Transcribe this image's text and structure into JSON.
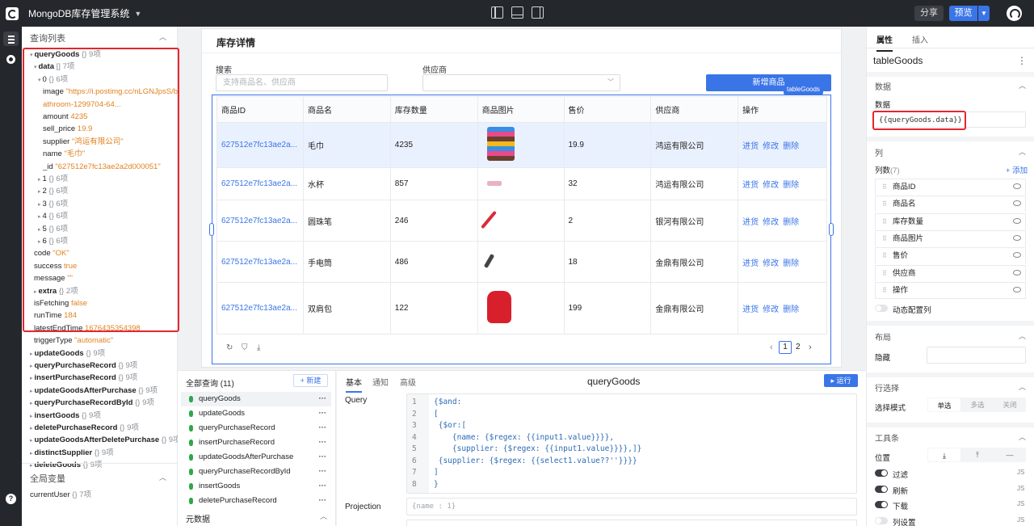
{
  "app": {
    "title": "MongoDB库存管理系统"
  },
  "topbar": {
    "share": "分享",
    "preview": "预览"
  },
  "left_panel": {
    "query_list_header": "查询列表",
    "tree": [
      {
        "key": "queryGoods",
        "meta": "{} 9项",
        "indent": 0,
        "arrow": "▾"
      },
      {
        "key": "data",
        "meta": "[] 7项",
        "indent": 1,
        "arrow": "▾"
      },
      {
        "key": "0",
        "meta": "{} 6项",
        "indent": 2,
        "arrow": "▾"
      },
      {
        "key": "image",
        "value": "\"https://i.postimg.cc/nLGNJpsS/b",
        "indent": 3,
        "vt": "s"
      },
      {
        "key": "",
        "value": "athroom-1299704-64...",
        "indent": 3,
        "vt": "s"
      },
      {
        "key": "amount",
        "value": "4235",
        "indent": 3,
        "vt": "n"
      },
      {
        "key": "sell_price",
        "value": "19.9",
        "indent": 3,
        "vt": "n"
      },
      {
        "key": "supplier",
        "value": "\"鸿运有限公司\"",
        "indent": 3,
        "vt": "s"
      },
      {
        "key": "name",
        "value": "\"毛巾\"",
        "indent": 3,
        "vt": "s"
      },
      {
        "key": "_id",
        "value": "\"627512e7fc13ae2a2d000051\"",
        "indent": 3,
        "vt": "s"
      },
      {
        "key": "1",
        "meta": "{} 6项",
        "indent": 2,
        "arrow": "▸"
      },
      {
        "key": "2",
        "meta": "{} 6项",
        "indent": 2,
        "arrow": "▸"
      },
      {
        "key": "3",
        "meta": "{} 6项",
        "indent": 2,
        "arrow": "▸"
      },
      {
        "key": "4",
        "meta": "{} 6项",
        "indent": 2,
        "arrow": "▸"
      },
      {
        "key": "5",
        "meta": "{} 6项",
        "indent": 2,
        "arrow": "▸"
      },
      {
        "key": "6",
        "meta": "{} 6项",
        "indent": 2,
        "arrow": "▸"
      },
      {
        "key": "code",
        "value": "\"OK\"",
        "indent": 1,
        "vt": "s"
      },
      {
        "key": "success",
        "value": "true",
        "indent": 1,
        "vt": "n"
      },
      {
        "key": "message",
        "value": "\"\"",
        "indent": 1,
        "vt": "s"
      },
      {
        "key": "extra",
        "meta": "{} 2项",
        "indent": 1,
        "arrow": "▸"
      },
      {
        "key": "isFetching",
        "value": "false",
        "indent": 1,
        "vt": "n"
      },
      {
        "key": "runTime",
        "value": "184",
        "indent": 1,
        "vt": "n"
      },
      {
        "key": "latestEndTime",
        "value": "1676435354398",
        "indent": 1,
        "vt": "n"
      },
      {
        "key": "triggerType",
        "value": "\"automatic\"",
        "indent": 1,
        "vt": "s"
      },
      {
        "key": "updateGoods",
        "meta": "{} 9项",
        "indent": 0,
        "arrow": "▸"
      },
      {
        "key": "queryPurchaseRecord",
        "meta": "{} 9项",
        "indent": 0,
        "arrow": "▸"
      },
      {
        "key": "insertPurchaseRecord",
        "meta": "{} 9项",
        "indent": 0,
        "arrow": "▸"
      },
      {
        "key": "updateGoodsAfterPurchase",
        "meta": "{} 9项",
        "indent": 0,
        "arrow": "▸"
      },
      {
        "key": "queryPurchaseRecordById",
        "meta": "{} 9项",
        "indent": 0,
        "arrow": "▸"
      },
      {
        "key": "insertGoods",
        "meta": "{} 9项",
        "indent": 0,
        "arrow": "▸"
      },
      {
        "key": "deletePurchaseRecord",
        "meta": "{} 9项",
        "indent": 0,
        "arrow": "▸"
      },
      {
        "key": "updateGoodsAfterDeletePurchase",
        "meta": "{} 9项",
        "indent": 0,
        "arrow": "▸"
      },
      {
        "key": "distinctSupplier",
        "meta": "{} 9项",
        "indent": 0,
        "arrow": "▸"
      },
      {
        "key": "deleteGoods",
        "meta": "{} 9项",
        "indent": 0,
        "arrow": "▸"
      }
    ],
    "globals_header": "全局变量",
    "globals": [
      {
        "key": "currentUser",
        "meta": "{} 7项"
      }
    ]
  },
  "canvas": {
    "card_title": "库存详情",
    "search_label": "搜索",
    "search_placeholder": "支持商品名、供应商",
    "supplier_label": "供应商",
    "supplier_value": "",
    "add_button": "新增商品",
    "table_tag": "tableGoods",
    "columns": [
      "商品ID",
      "商品名",
      "库存数量",
      "商品图片",
      "售价",
      "供应商",
      "操作"
    ],
    "rows": [
      {
        "id": "627512e7fc13ae2a...",
        "name": "毛巾",
        "amount": "4235",
        "image": "towel-stack",
        "price": "19.9",
        "supplier": "鸿运有限公司"
      },
      {
        "id": "627512e7fc13ae2a...",
        "name": "水杯",
        "amount": "857",
        "image": "cup",
        "price": "32",
        "supplier": "鸿运有限公司"
      },
      {
        "id": "627512e7fc13ae2a...",
        "name": "圆珠笔",
        "amount": "246",
        "image": "pen",
        "price": "2",
        "supplier": "银河有限公司"
      },
      {
        "id": "627512e7fc13ae2a...",
        "name": "手电筒",
        "amount": "486",
        "image": "flashlight",
        "price": "18",
        "supplier": "金鼎有限公司"
      },
      {
        "id": "627512e7fc13ae2a...",
        "name": "双肩包",
        "amount": "122",
        "image": "backpack",
        "price": "199",
        "supplier": "金鼎有限公司"
      }
    ],
    "actions": [
      "进货",
      "修改",
      "删除"
    ],
    "pagination": {
      "current": "1",
      "next": "2"
    }
  },
  "query_list": {
    "title": "全部查询 (11)",
    "new_button": "+ 新建",
    "items": [
      "queryGoods",
      "updateGoods",
      "queryPurchaseRecord",
      "insertPurchaseRecord",
      "updateGoodsAfterPurchase",
      "queryPurchaseRecordById",
      "insertGoods",
      "deletePurchaseRecord"
    ],
    "meta_header": "元数据"
  },
  "editor": {
    "tabs": [
      "基本",
      "通知",
      "高级"
    ],
    "title": "queryGoods",
    "run_button": "▸ 运行",
    "query_label": "Query",
    "code_lines": [
      "{$and:",
      "[",
      " {$or:[",
      "    {name: {$regex: {{input1.value}}}},",
      "    {supplier: {$regex: {{input1.value}}}},]}",
      " {supplier: {$regex: {{select1.value??''}}}}",
      "]",
      "}"
    ],
    "projection_label": "Projection",
    "projection_placeholder": "{name : 1}"
  },
  "right_panel": {
    "tab_props": "属性",
    "tab_insert": "插入",
    "component_name": "tableGoods",
    "data_section": "数据",
    "data_label": "数据",
    "data_value": "{{queryGoods.data}}",
    "columns_section": "列",
    "columns_count_label": "列数",
    "columns_count": "(7)",
    "add_column": "+ 添加",
    "columns": [
      "商品ID",
      "商品名",
      "库存数量",
      "商品图片",
      "售价",
      "供应商",
      "操作"
    ],
    "dynamic_columns": "动态配置列",
    "layout_section": "布局",
    "hide_label": "隐藏",
    "row_select_section": "行选择",
    "select_mode_label": "选择模式",
    "select_modes": [
      "单选",
      "多选",
      "关闭"
    ],
    "toolbar_section": "工具条",
    "position_label": "位置",
    "toggles": [
      {
        "label": "过滤",
        "on": true
      },
      {
        "label": "刷新",
        "on": true
      },
      {
        "label": "下载",
        "on": true
      },
      {
        "label": "列设置",
        "on": false
      }
    ],
    "js_tag": "JS"
  }
}
